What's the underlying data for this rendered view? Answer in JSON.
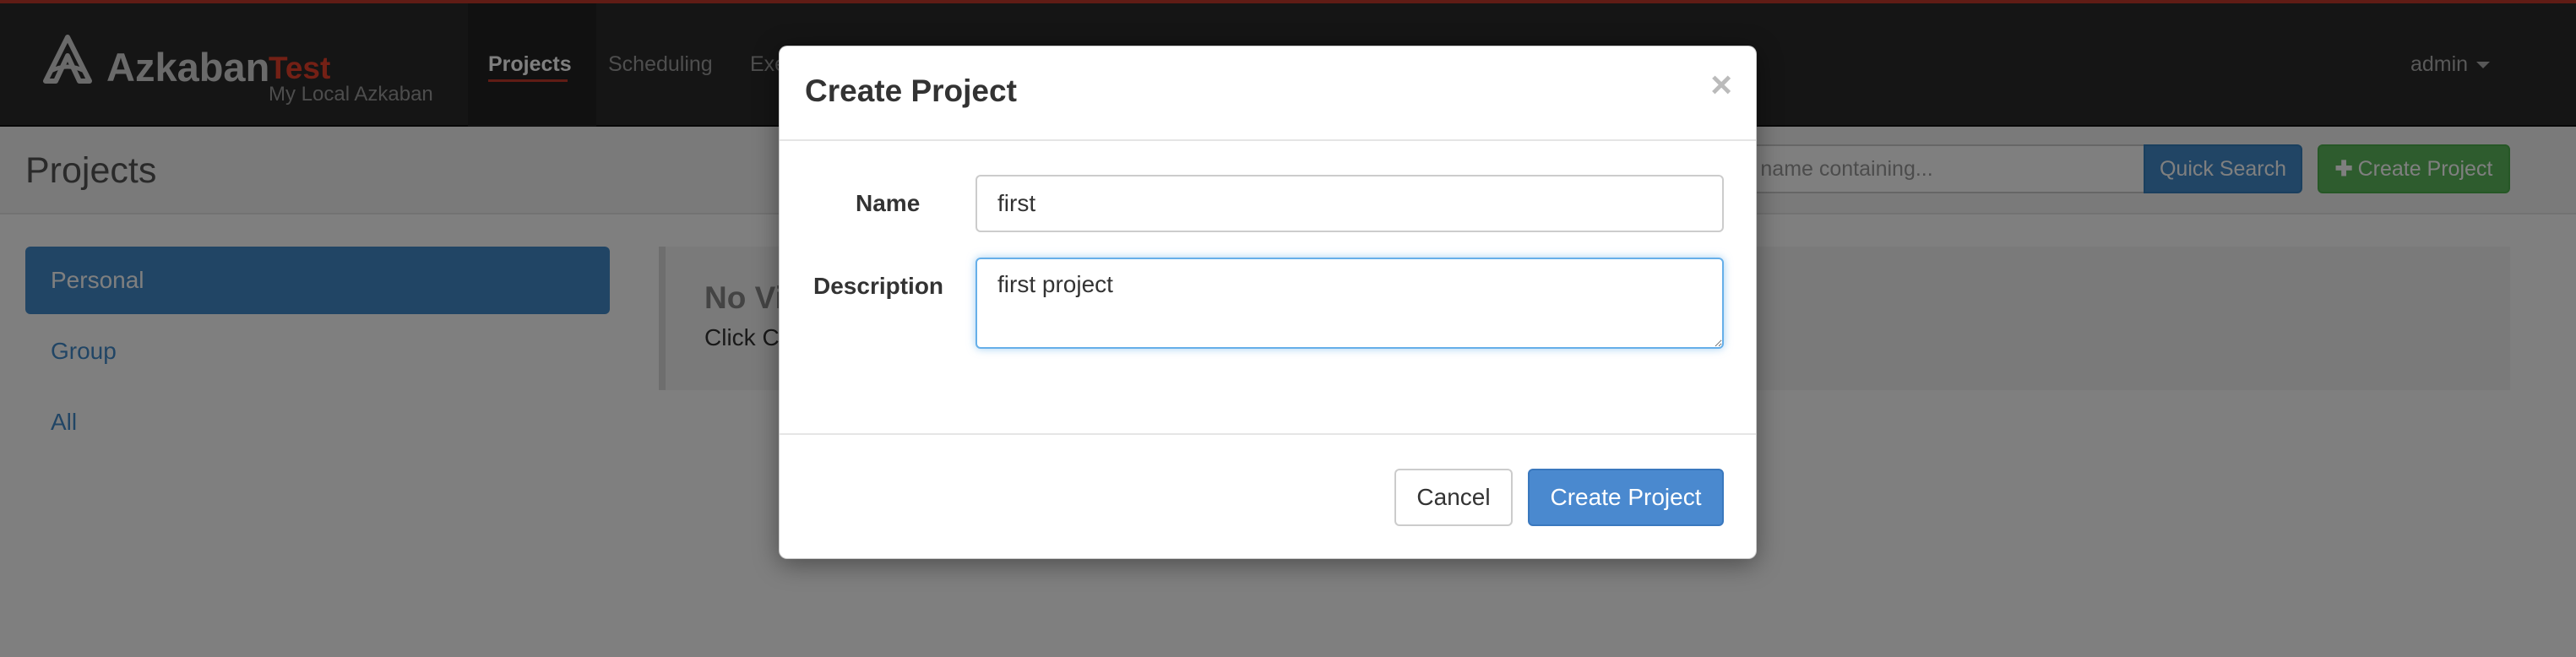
{
  "navbar": {
    "brand_name": "Azkaban",
    "brand_env": "Test",
    "brand_subtitle": "My Local Azkaban",
    "links": [
      {
        "label": "Projects",
        "active": true
      },
      {
        "label": "Scheduling",
        "active": false
      },
      {
        "label": "Exe",
        "active": false
      }
    ],
    "user_label": "admin",
    "accent_color": "#c0392b"
  },
  "header": {
    "title": "Projects",
    "search_placeholder": "ct name containing...",
    "quick_search_label": "Quick Search",
    "create_project_label": "Create Project"
  },
  "sidebar": {
    "items": [
      {
        "label": "Personal",
        "active": true
      },
      {
        "label": "Group",
        "active": false
      },
      {
        "label": "All",
        "active": false
      }
    ]
  },
  "main": {
    "panel_title": "No Vi",
    "panel_text": "Click Cr"
  },
  "modal": {
    "title": "Create Project",
    "close_symbol": "×",
    "name_label": "Name",
    "name_value": "first",
    "description_label": "Description",
    "description_value": "first project",
    "cancel_label": "Cancel",
    "submit_label": "Create Project"
  },
  "colors": {
    "primary": "#428bca",
    "success": "#5cb85c",
    "navbar_bg": "#2a2a2a"
  }
}
